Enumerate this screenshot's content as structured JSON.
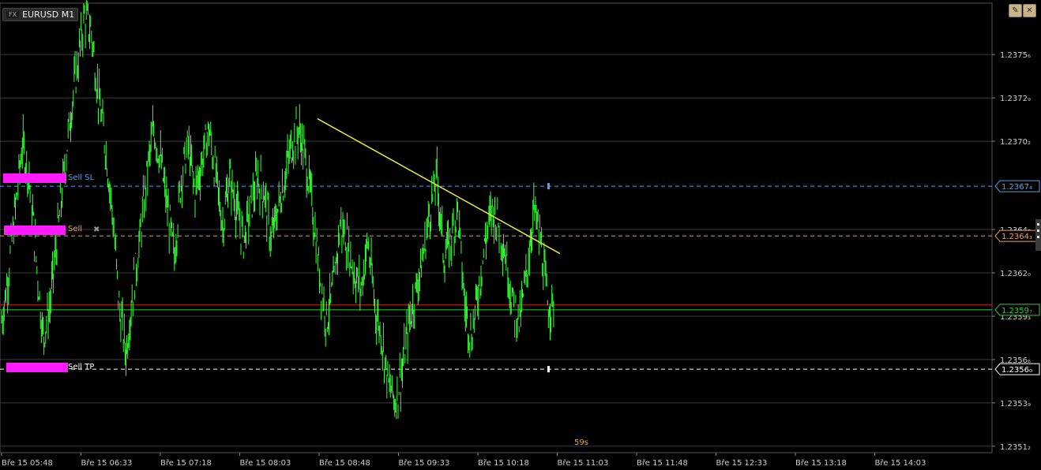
{
  "window": {
    "badge": "FX",
    "title": "EURUSD M1",
    "buttons": [
      {
        "name": "edit-icon",
        "glyph": "✎"
      },
      {
        "name": "close-icon",
        "glyph": "✕"
      }
    ]
  },
  "colors": {
    "background": "#000000",
    "grid": "#3a3a3a",
    "price_series": "#33ff33",
    "trendline": "#e6e645",
    "sell_sl": "#4aa3ff",
    "sell_entry": "#e8a06a",
    "sell_tp": "#ffffff",
    "bid_line": "#33cc33",
    "ask_line": "#cc2222",
    "order_block": "#ff1aff",
    "countdown": "#e8a33c"
  },
  "countdown": "59s",
  "orders": [
    {
      "label": "Sell  SL",
      "price_label": "1.2367₄",
      "role": "sl"
    },
    {
      "label": "Sell",
      "price_label": "1.2364₃",
      "role": "entry",
      "close_glyph": "✖"
    },
    {
      "label": "Sell  TP",
      "price_label": "1.2356₀",
      "role": "tp"
    }
  ],
  "chart_data": {
    "type": "line",
    "symbol": "EURUSD",
    "timeframe": "M1",
    "ylim": [
      1.23508,
      1.23788
    ],
    "y_ticks": [
      "1.2375₆",
      "1.2372₉",
      "1.2370₂",
      "1.2367₄",
      "1.2364₇",
      "1.2364₃",
      "1.2362₀",
      "1.2359₃",
      "1.2356₆",
      "1.2356₀",
      "1.2353₉",
      "1.2351₂"
    ],
    "y_tick_values": [
      1.23756,
      1.23729,
      1.23702,
      1.23674,
      1.23647,
      1.23643,
      1.2362,
      1.23593,
      1.23566,
      1.2356,
      1.23539,
      1.23512
    ],
    "x_ticks": [
      "Bře 15 05:48",
      "Bře 15 06:33",
      "Bře 15 07:18",
      "Bře 15 08:03",
      "Bře 15 08:48",
      "Bře 15 09:33",
      "Bře 15 10:18",
      "Bře 15 11:03",
      "Bře 15 11:48",
      "Bře 15 12:33",
      "Bře 15 13:18",
      "Bře 15 14:03"
    ],
    "bid_price": 1.23597,
    "bid_label": "1.2359₇",
    "ask_price": 1.236,
    "trendline": {
      "start": [
        248,
        1.23716
      ],
      "end": [
        468,
        1.23632
      ]
    },
    "series": [
      {
        "values": [
          1.2359,
          1.2362,
          1.2366,
          1.237,
          1.2368,
          1.2363,
          1.2358,
          1.236,
          1.2364,
          1.2368,
          1.2372,
          1.2375,
          1.2378,
          1.2377,
          1.2373,
          1.237,
          1.2366,
          1.236,
          1.2357,
          1.2361,
          1.2364,
          1.2368,
          1.2371,
          1.2369,
          1.2366,
          1.2363,
          1.2368,
          1.237,
          1.2367,
          1.2369,
          1.2371,
          1.2368,
          1.2365,
          1.2368,
          1.2366,
          1.2364,
          1.2366,
          1.2368,
          1.2367,
          1.2364,
          1.2366,
          1.2368,
          1.237,
          1.2371,
          1.2369,
          1.2366,
          1.2362,
          1.2359,
          1.2361,
          1.2365,
          1.2364,
          1.2362,
          1.2361,
          1.2364,
          1.236,
          1.2358,
          1.2355,
          1.2354,
          1.2356,
          1.2359,
          1.2361,
          1.2363,
          1.2366,
          1.2368,
          1.2363,
          1.2364,
          1.2366,
          1.236,
          1.2358,
          1.2361,
          1.2364,
          1.2366,
          1.2365,
          1.2363,
          1.236,
          1.2359,
          1.2362,
          1.2366,
          1.2364,
          1.236,
          1.236
        ]
      }
    ]
  }
}
